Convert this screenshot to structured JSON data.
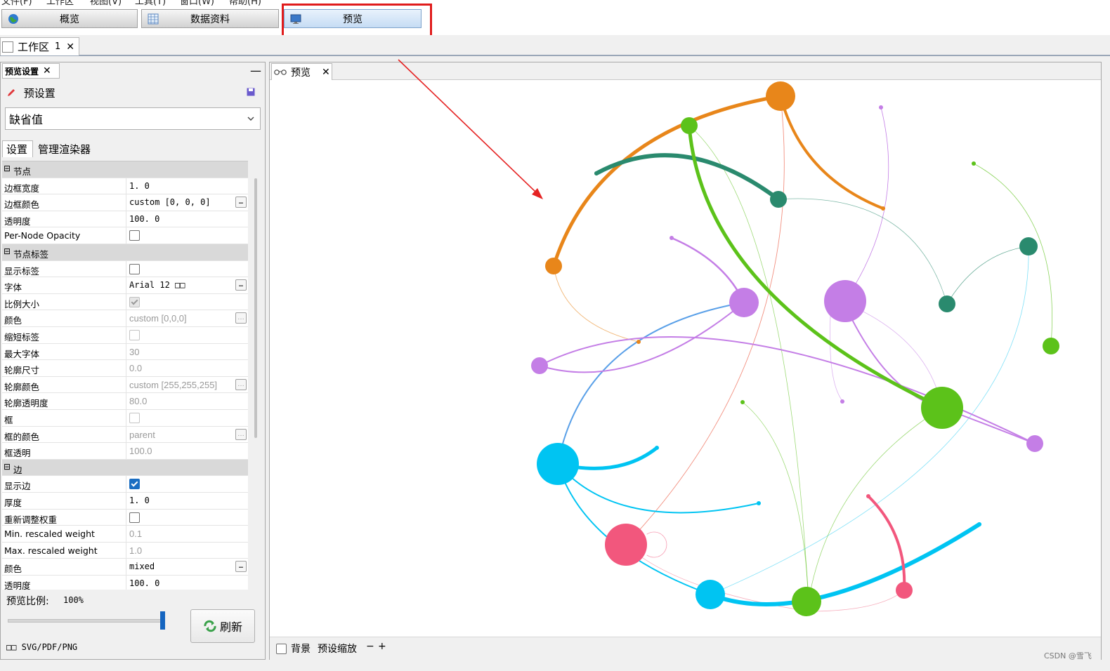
{
  "menubar": {
    "items": [
      "文件(F)",
      "工作区",
      "视图(V)",
      "工具(T)",
      "窗口(W)",
      "帮助(H)"
    ]
  },
  "topnav": {
    "buttons": [
      {
        "label": "概览",
        "icon": "globe-icon"
      },
      {
        "label": "数据资料",
        "icon": "table-icon"
      },
      {
        "label": "预览",
        "icon": "monitor-icon",
        "active": true
      }
    ],
    "highlight_color": "#e01c1c"
  },
  "workspace": {
    "tab_label": "工作区",
    "tab_number": "1",
    "close": "✕"
  },
  "left_panel": {
    "tab_label": "预览设置",
    "close": "✕",
    "minimize": "—",
    "preset_label": "预设置",
    "preset_value": "缺省值",
    "subtabs": [
      "设置",
      "管理渲染器"
    ],
    "sections": [
      {
        "title": "节点",
        "rows": [
          {
            "key": "边框宽度",
            "value": "1. 0"
          },
          {
            "key": "边框颜色",
            "value": "custom [0, 0, 0]",
            "button": true
          },
          {
            "key": "透明度",
            "value": "100. 0"
          },
          {
            "key": "Per-Node Opacity",
            "check": "off"
          }
        ]
      },
      {
        "title": "节点标签",
        "rows": [
          {
            "key": "显示标签",
            "check": "off"
          },
          {
            "key": "字体",
            "value": "Arial 12 □□",
            "button": true
          },
          {
            "key": "比例大小",
            "check": "grey"
          },
          {
            "key": "颜色",
            "value": "custom [0,0,0]",
            "button": true,
            "dim": true
          },
          {
            "key": "缩短标签",
            "check": "dim"
          },
          {
            "key": "最大字体",
            "value": "30",
            "dim": true
          },
          {
            "key": "轮廓尺寸",
            "value": "0.0",
            "dim": true
          },
          {
            "key": "轮廓颜色",
            "value": "custom [255,255,255]",
            "button": true,
            "dim": true
          },
          {
            "key": "轮廓透明度",
            "value": "80.0",
            "dim": true
          },
          {
            "key": "框",
            "check": "dim"
          },
          {
            "key": "框的颜色",
            "value": "parent",
            "button": true,
            "dim": true
          },
          {
            "key": "框透明",
            "value": "100.0",
            "dim": true
          }
        ]
      },
      {
        "title": "边",
        "rows": [
          {
            "key": "显示边",
            "check": "on"
          },
          {
            "key": "厚度",
            "value": "1. 0"
          },
          {
            "key": "重新调整权重",
            "check": "off"
          },
          {
            "key": "Min. rescaled weight",
            "value": "0.1",
            "dim": true
          },
          {
            "key": "Max. rescaled weight",
            "value": "1.0",
            "dim": true
          },
          {
            "key": "颜色",
            "value": "mixed",
            "button": true
          },
          {
            "key": "透明度",
            "value": "100. 0"
          }
        ]
      }
    ],
    "preview_ratio_label": "预览比例:",
    "preview_ratio_value": "100%",
    "preview_ratio_fraction": 1.0,
    "refresh_label": "刷新",
    "export_label": "□□  SVG/PDF/PNG"
  },
  "preview": {
    "tab_label": "预览",
    "close": "✕",
    "background_label": "背景",
    "zoom_label": "预设缩放",
    "zoom_minus": "−",
    "zoom_plus": "+"
  },
  "colors": {
    "orange": "#e8861a",
    "green": "#5cc21a",
    "teal": "#2a8a6e",
    "purple": "#c47ee6",
    "cyan": "#00c4f2",
    "pink": "#f2577d",
    "arrow": "#e52222"
  },
  "watermark": "CSDN @雪飞"
}
